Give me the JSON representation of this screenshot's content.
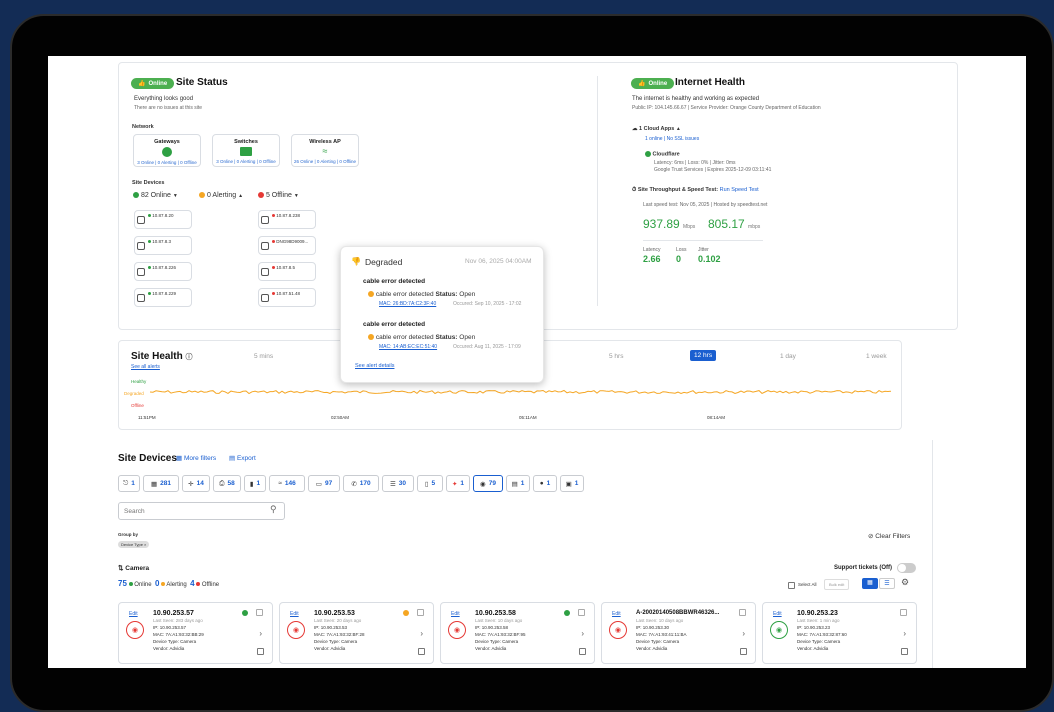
{
  "site_status": {
    "pill": "Online",
    "title": "Site Status",
    "subtitle": "Everything looks good",
    "note": "There are no issues at this site",
    "network_label": "Network",
    "network": [
      {
        "name": "Gateways",
        "stats": "3 Online | 0 Alerting | 0 Offline"
      },
      {
        "name": "Switches",
        "stats": "3 Online | 0 Alerting | 0 Offline"
      },
      {
        "name": "Wireless AP",
        "stats": "26 Online | 0 Alerting | 0 Offline"
      }
    ],
    "site_devices_label": "Site Devices",
    "online": "82 Online",
    "alerting": "0 Alerting",
    "offline": "5 Offline"
  },
  "internet_health": {
    "pill": "Online",
    "title": "Internet Health",
    "subtitle": "The internet is healthy and working as expected",
    "note": "Public IP: 104.145.66.67 | Service Provider: Orange County Department of Education",
    "cloud_apps": "1 Cloud Apps",
    "cloud_summary": "1 online | No SSL issues",
    "cloudflare": "Cloudflare",
    "cloudflare_note": "Latency: 6ms | Loss: 0% | Jitter: 0ms",
    "cloudflare_cert": "Google Trust Services | Expires 2025-12-09 03:11:41",
    "throughput_label": "Site Throughput & Speed Test",
    "run_speed": "Run Speed Test",
    "last_speed": "Last speed test: Nov 05, 2025 | Hosted by speedtest.net",
    "down": "937.89",
    "down_unit": "Mbps",
    "up": "805.17",
    "up_unit": "mbps",
    "metric_labels": [
      "Latency",
      "Loss",
      "Jitter"
    ],
    "latency": "2.66",
    "loss": "0",
    "jitter": "0.102"
  },
  "tooltip": {
    "status": "Degraded",
    "date": "Nov 06, 2025 04:00AM",
    "events": [
      {
        "heading": "cable error detected",
        "line": "cable error detected",
        "status_label": "Status:",
        "status": "Open",
        "mac": "MAC: 26:BD:7A:C2:3F:40",
        "occured": "Occured: Sep 10, 2025 - 17:02"
      },
      {
        "heading": "cable error detected",
        "line": "cable error detected",
        "status_label": "Status:",
        "status": "Open",
        "mac": "MAC: 14:AB:EC:EC:51:40",
        "occured": "Occured: Aug 11, 2025 - 17:09"
      }
    ],
    "see_alert": "See alert details"
  },
  "site_health": {
    "title": "Site Health",
    "see_all": "See all alerts",
    "ranges": [
      "5 mins",
      "5 hrs",
      "12 hrs",
      "1 day",
      "1 week"
    ],
    "legend": [
      "Healthy",
      "Degraded",
      "Offline"
    ],
    "times": [
      "11:51PM",
      "02:50AM",
      "05:11AM",
      "08:14AM"
    ]
  },
  "devices": {
    "title": "Site Devices",
    "more_filters": "More filters",
    "export": "Export",
    "filters": [
      "1",
      "281",
      "14",
      "58",
      "1",
      "146",
      "97",
      "170",
      "30",
      "5",
      "1",
      "79",
      "1",
      "1",
      "1"
    ],
    "search_placeholder": "Search",
    "group_by": "Group by",
    "group_tag": "Device Type ×",
    "clear": "Clear Filters",
    "camera_label": "Camera",
    "support": "Support tickets (Off)",
    "cam_online": "75",
    "cam_online_label": "Online",
    "cam_alerting": "0",
    "cam_alerting_label": "Alerting",
    "cam_offline": "4",
    "cam_offline_label": "Offline",
    "select_all": "Select All",
    "bulk_edit": "Bulk edit",
    "edit": "Edit",
    "cards": [
      {
        "ip": "10.90.253.57",
        "seen": "Last Seen: 283 days ago",
        "ipline": "IP: 10.90.253.57",
        "mac": "MAC: 7A:A1:93:32:BB:29",
        "type": "Device Type: Camera",
        "vendor": "Vendor: Advidia"
      },
      {
        "ip": "10.90.253.53",
        "seen": "Last Seen: 20 days ago",
        "ipline": "IP: 10.90.253.53",
        "mac": "MAC: 7A:A1:93:32:BF:28",
        "type": "Device Type: Camera",
        "vendor": "Vendor: Advidia"
      },
      {
        "ip": "10.90.253.58",
        "seen": "Last Seen: 10 days ago",
        "ipline": "IP: 10.90.253.58",
        "mac": "MAC: 7A:A1:93:32:BF:95",
        "type": "Device Type: Camera",
        "vendor": "Vendor: Advidia"
      },
      {
        "ip": "A-20020140508BBWR46326...",
        "seen": "Last Seen: 10 days ago",
        "ipline": "IP: 10.90.253.30",
        "mac": "MAC: 7A:A1:93:41:11:BA",
        "type": "Device Type: Camera",
        "vendor": "Vendor: Advidia"
      },
      {
        "ip": "10.90.253.23",
        "seen": "Last Seen: 1 min ago",
        "ipline": "IP: 10.90.253.23",
        "mac": "MAC: 7A:A1:93:32:87:60",
        "type": "Device Type: Camera",
        "vendor": "Vendor: Advidia"
      }
    ]
  },
  "mini_devices": [
    {
      "name": "10.87.8.20"
    },
    {
      "name": "10.87.8.3"
    },
    {
      "name": "10.87.8.226"
    },
    {
      "name": "10.87.8.229"
    },
    {
      "name": "10.87.8.238"
    },
    {
      "name": "DNG98D9009..."
    },
    {
      "name": "10.87.8.5"
    },
    {
      "name": "10.87.51.48"
    }
  ],
  "colors": {
    "online": "#2ea043",
    "alerting": "#f5a623",
    "offline": "#e53935",
    "accent": "#1a5fd0"
  }
}
